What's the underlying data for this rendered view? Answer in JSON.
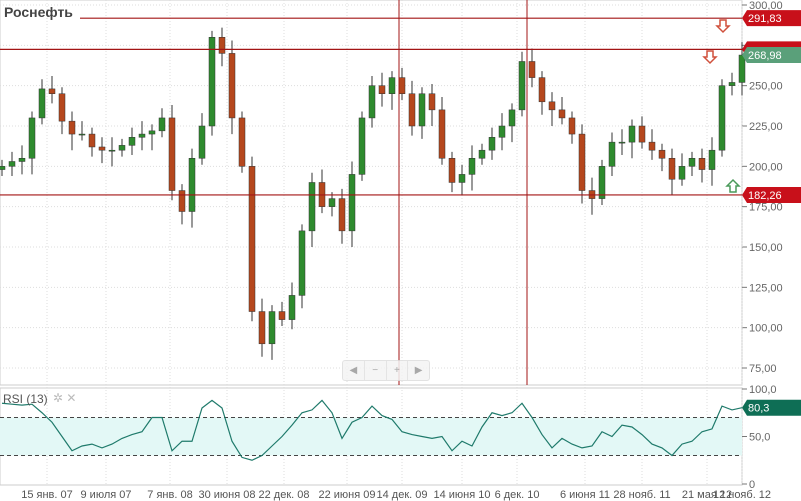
{
  "title": "Роснефть",
  "chart_data": {
    "type": "candlestick",
    "title": "Роснефть",
    "close": [
      200,
      203,
      205,
      230,
      248,
      245,
      228,
      220,
      220,
      212,
      210,
      210,
      213,
      218,
      220,
      222,
      230,
      185,
      172,
      205,
      225,
      280,
      270,
      230,
      200,
      110,
      90,
      110,
      105,
      120,
      160,
      190,
      175,
      180,
      160,
      195,
      230,
      250,
      245,
      255,
      245,
      225,
      245,
      235,
      205,
      190,
      195,
      205,
      210,
      218,
      225,
      235,
      265,
      255,
      240,
      235,
      230,
      220,
      185,
      180,
      200,
      215,
      215,
      225,
      215,
      210,
      205,
      192,
      200,
      205,
      198,
      210,
      250,
      252,
      268.98
    ],
    "ylim": [
      70,
      305
    ],
    "y_ticks": [
      "300,00",
      "275,00",
      "250,00",
      "225,00",
      "200,00",
      "175,00",
      "150,00",
      "125,00",
      "100,00",
      "75,00"
    ],
    "y_tick_values": [
      300,
      275,
      250,
      225,
      200,
      175,
      150,
      125,
      100,
      75
    ],
    "x_ticks": [
      "15 янв. 07",
      "9 июля 07",
      "7 янв. 08",
      "30 июня 08",
      "22 дек. 08",
      "22 июня 09",
      "14 дек. 09",
      "14 июня 10",
      "6 дек. 10",
      "6 июня 11",
      "28 нояб. 11",
      "21 мая 12",
      "12 нояб. 12"
    ],
    "x_tick_index": [
      4.5,
      10.4,
      16.8,
      22.5,
      28.2,
      34.5,
      40,
      46,
      51.5,
      58.3,
      64,
      70.5,
      74
    ],
    "horizontal_lines": [
      {
        "value": 291.83,
        "label": "291,83"
      },
      {
        "value": 272.5,
        "label": ""
      },
      {
        "value": 182.26,
        "label": "182,26"
      }
    ],
    "vertical_lines_index": [
      39.7,
      52.5
    ],
    "last_price_label": "268,98",
    "colors": {
      "up": "#2e8b2e",
      "down": "#b5471d",
      "line": "#a31515",
      "label_red": "#c8101a",
      "label_green": "#5aa07a"
    },
    "rsi": {
      "title": "RSI (13)",
      "values": [
        85,
        84,
        83,
        84,
        75,
        65,
        50,
        35,
        40,
        42,
        38,
        42,
        48,
        52,
        55,
        70,
        70,
        35,
        45,
        45,
        80,
        88,
        80,
        45,
        28,
        25,
        30,
        40,
        50,
        62,
        75,
        78,
        88,
        75,
        48,
        65,
        70,
        82,
        72,
        68,
        55,
        52,
        50,
        48,
        50,
        35,
        45,
        40,
        60,
        75,
        72,
        75,
        85,
        70,
        52,
        38,
        48,
        42,
        38,
        40,
        55,
        50,
        62,
        60,
        52,
        42,
        38,
        30,
        42,
        45,
        55,
        58,
        82,
        78,
        80.3
      ],
      "ylim": [
        0,
        100
      ],
      "y_ticks": [
        "100,0",
        "50,0",
        "0"
      ],
      "y_tick_values": [
        100,
        50,
        0
      ],
      "overbought": 70,
      "oversold": 30,
      "last_label": "80,3",
      "color": "#1f7a6b"
    }
  },
  "nav": {
    "prev": "◀",
    "zoom_out": "−",
    "zoom_in": "+",
    "next": "▶"
  },
  "rsi_icons": {
    "gear": "✲",
    "close": "✕"
  }
}
